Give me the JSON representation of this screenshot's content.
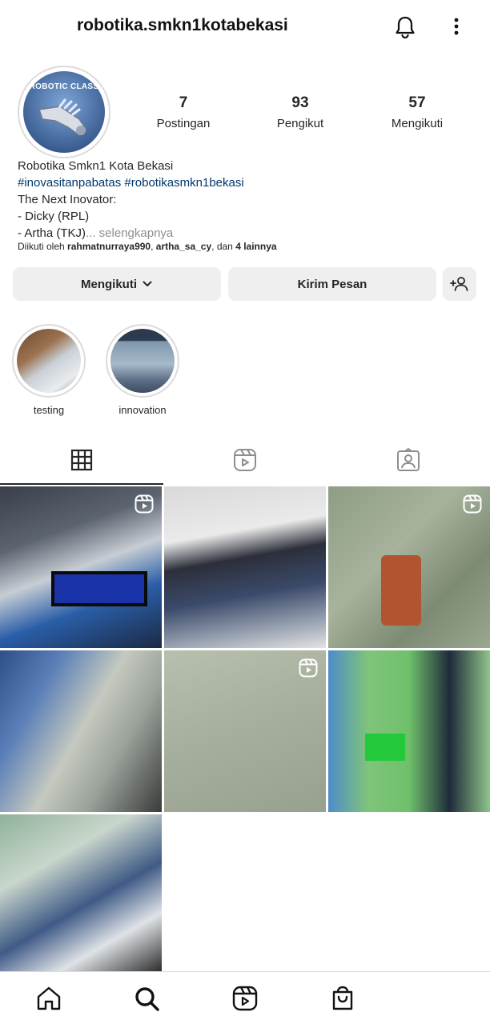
{
  "header": {
    "username": "robotika.smkn1kotabekasi",
    "icons": [
      "bell-icon",
      "more-vertical-icon"
    ]
  },
  "profile": {
    "avatar_text": "ROBOTIC CLASS",
    "stats": [
      {
        "value": "7",
        "label": "Postingan"
      },
      {
        "value": "93",
        "label": "Pengikut"
      },
      {
        "value": "57",
        "label": "Mengikuti"
      }
    ],
    "bio": {
      "name": "Robotika Smkn1 Kota Bekasi",
      "hashtags": "#inovasitanpabatas #robotikasmkn1bekasi",
      "line1": "The Next Inovator:",
      "line2": "- Dicky (RPL)",
      "line3": "- Artha (TKJ)",
      "more": "... selengkapnya"
    },
    "followed_by": {
      "prefix": "Diikuti oleh ",
      "user1": "rahmatnurraya990",
      "sep": ", ",
      "user2": "artha_sa_cy",
      "mid": ", dan ",
      "others": "4 lainnya"
    }
  },
  "actions": {
    "follow_label": "Mengikuti",
    "message_label": "Kirim Pesan"
  },
  "highlights": [
    {
      "label": "testing"
    },
    {
      "label": "innovation"
    }
  ],
  "tabs": [
    "grid-icon",
    "reels-icon",
    "tagged-icon"
  ],
  "posts": [
    {
      "type": "reel"
    },
    {
      "type": "photo"
    },
    {
      "type": "reel"
    },
    {
      "type": "photo"
    },
    {
      "type": "reel"
    },
    {
      "type": "photo"
    },
    {
      "type": "photo"
    }
  ],
  "bottom_nav": [
    "home-icon",
    "search-icon",
    "reels-icon",
    "shop-icon"
  ],
  "colors": {
    "link": "#00376b",
    "muted": "#8e8e8e",
    "button_bg": "#efefef"
  }
}
